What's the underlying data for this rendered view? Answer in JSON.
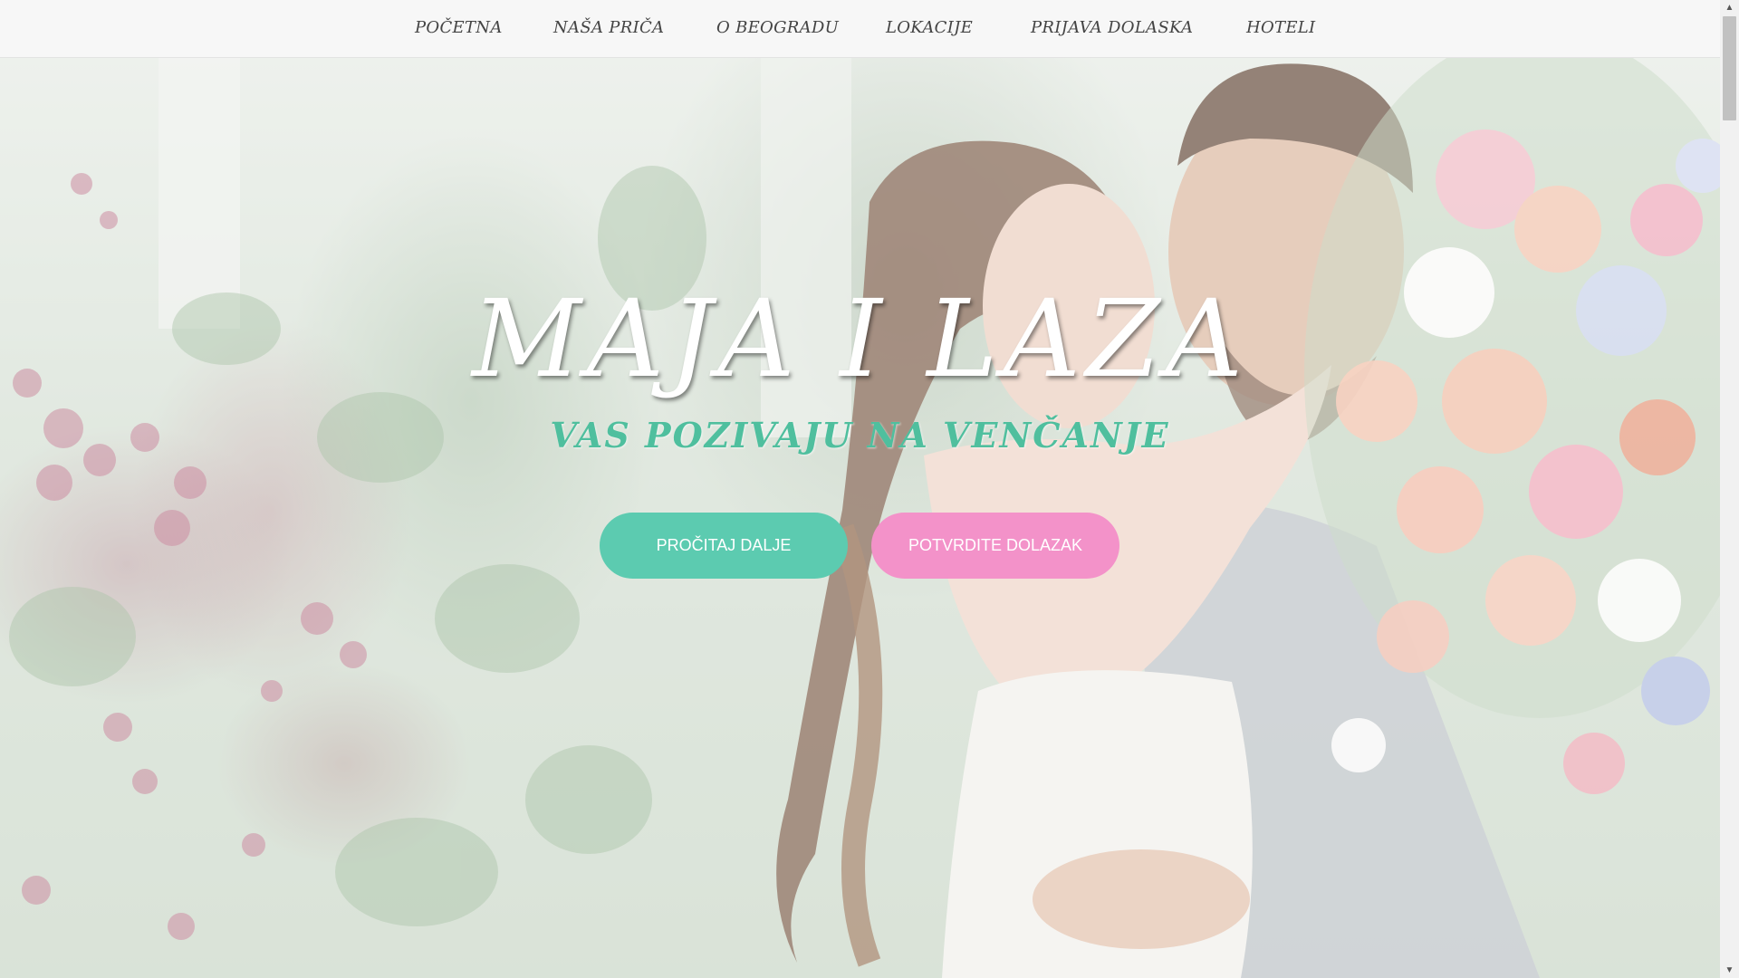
{
  "nav": {
    "items": [
      {
        "label": "POČETNA"
      },
      {
        "label": "NAŠA PRIČA"
      },
      {
        "label": "O BEOGRADU"
      },
      {
        "label": "LOKACIJE"
      },
      {
        "label": "PRIJAVA DOLASKA"
      },
      {
        "label": "HOTELI"
      }
    ]
  },
  "hero": {
    "title": "MAJA I LAZA",
    "subtitle": "VAS POZIVAJU NA VENČANJE",
    "buttons": {
      "read_more": "PROČITAJ DALJE",
      "rsvp": "POTVRDITE DOLAZAK"
    }
  },
  "colors": {
    "teal": "#5ccbb0",
    "pink": "#f392c9",
    "subtitle": "#4fbf9e",
    "nav_bg": "#f7f7f7"
  },
  "icons": {
    "scroll_up": "triangle-up",
    "scroll_down": "triangle-down"
  }
}
